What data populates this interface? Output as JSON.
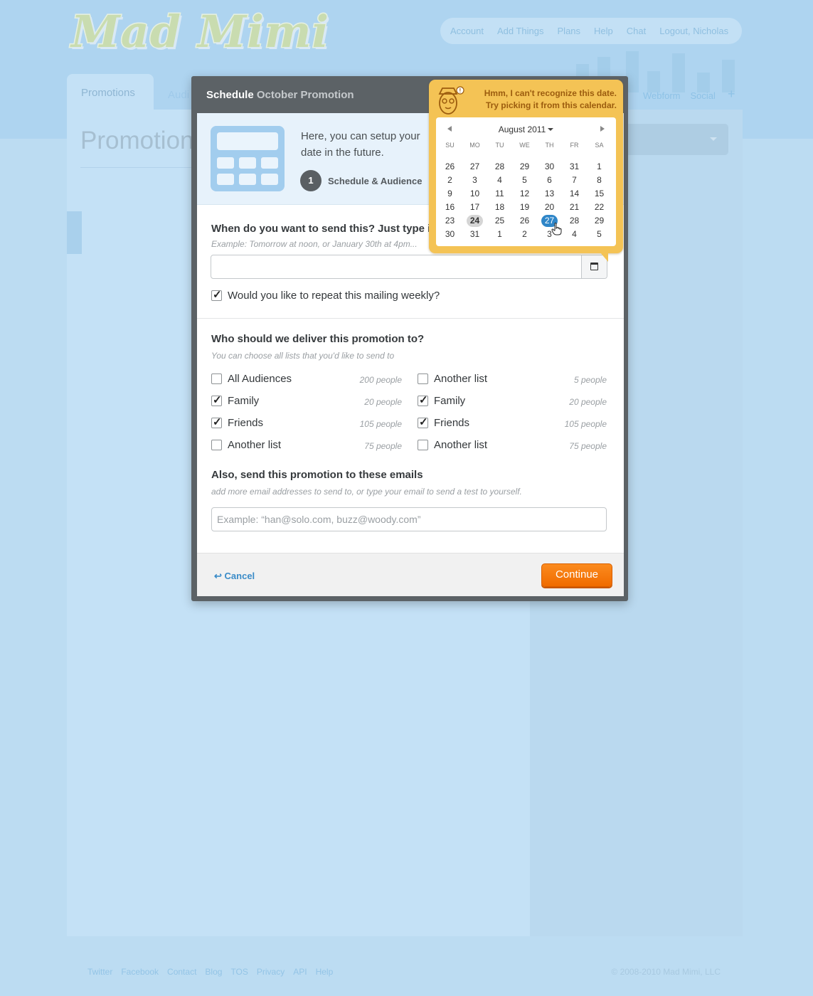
{
  "brand": {
    "logo_text": "Mad Mimi"
  },
  "topnav": [
    "Account",
    "Add Things",
    "Plans",
    "Help",
    "Chat",
    "Logout, Nicholas"
  ],
  "tabs": {
    "active": "Promotions",
    "second": "Audi",
    "right": [
      "Webform",
      "Social"
    ],
    "add": "+"
  },
  "bg_page_title": "Promotions",
  "modal": {
    "title_bold": "Schedule",
    "title_rest": "October Promotion",
    "intro_text": "Here, you can setup your date in the future.",
    "step_number": "1",
    "step_label": "Schedule & Audience",
    "when_question": "When do you want to send this? Just type it",
    "when_hint": "Example: Tomorrow at noon, or January 30th at 4pm...",
    "date_value": "",
    "repeat_label": "Would you like to repeat this mailing weekly?",
    "repeat_checked": true,
    "who_question": "Who should we deliver this promotion to?",
    "who_hint": "You can choose all lists that you'd like to send to",
    "audiences_left": [
      {
        "name": "All Audiences",
        "count": "200 people",
        "checked": false
      },
      {
        "name": "Family",
        "count": "20 people",
        "checked": true
      },
      {
        "name": "Friends",
        "count": "105 people",
        "checked": true
      },
      {
        "name": "Another list",
        "count": "75 people",
        "checked": false
      }
    ],
    "audiences_right": [
      {
        "name": "Another list",
        "count": "5 people",
        "checked": false
      },
      {
        "name": "Family",
        "count": "20 people",
        "checked": true
      },
      {
        "name": "Friends",
        "count": "105 people",
        "checked": true
      },
      {
        "name": "Another list",
        "count": "75 people",
        "checked": false
      }
    ],
    "emails_question": "Also, send this promotion to these emails",
    "emails_hint": "add more email addresses to send to, or type your email to send a test to yourself.",
    "emails_placeholder": "Example: “han@solo.com, buzz@woody.com”",
    "cancel_label": "Cancel",
    "continue_label": "Continue"
  },
  "tooltip": {
    "message_line1": "Hmm, I can't recognize this date.",
    "message_line2": "Try picking it from this calendar.",
    "month_label": "August 2011",
    "weekdays": [
      "SU",
      "MO",
      "TU",
      "WE",
      "TH",
      "FR",
      "SA"
    ],
    "days": [
      "26",
      "27",
      "28",
      "29",
      "30",
      "31",
      "1",
      "2",
      "3",
      "4",
      "5",
      "6",
      "7",
      "8",
      "9",
      "10",
      "11",
      "12",
      "13",
      "14",
      "15",
      "16",
      "17",
      "18",
      "19",
      "20",
      "21",
      "22",
      "23",
      "24",
      "25",
      "26",
      "27",
      "28",
      "29",
      "30",
      "31",
      "1",
      "2",
      "3",
      "4",
      "5"
    ],
    "today_index": 29,
    "selected_index": 32
  },
  "footer": {
    "links": [
      "Twitter",
      "Facebook",
      "Contact",
      "Blog",
      "TOS",
      "Privacy",
      "API",
      "Help"
    ],
    "copyright": "© 2008-2010 Mad Mimi, LLC"
  },
  "colors": {
    "accent": "#f06c00",
    "link": "#3b8cc8",
    "tooltip": "#f4c355",
    "selected_day": "#2f86c8"
  }
}
